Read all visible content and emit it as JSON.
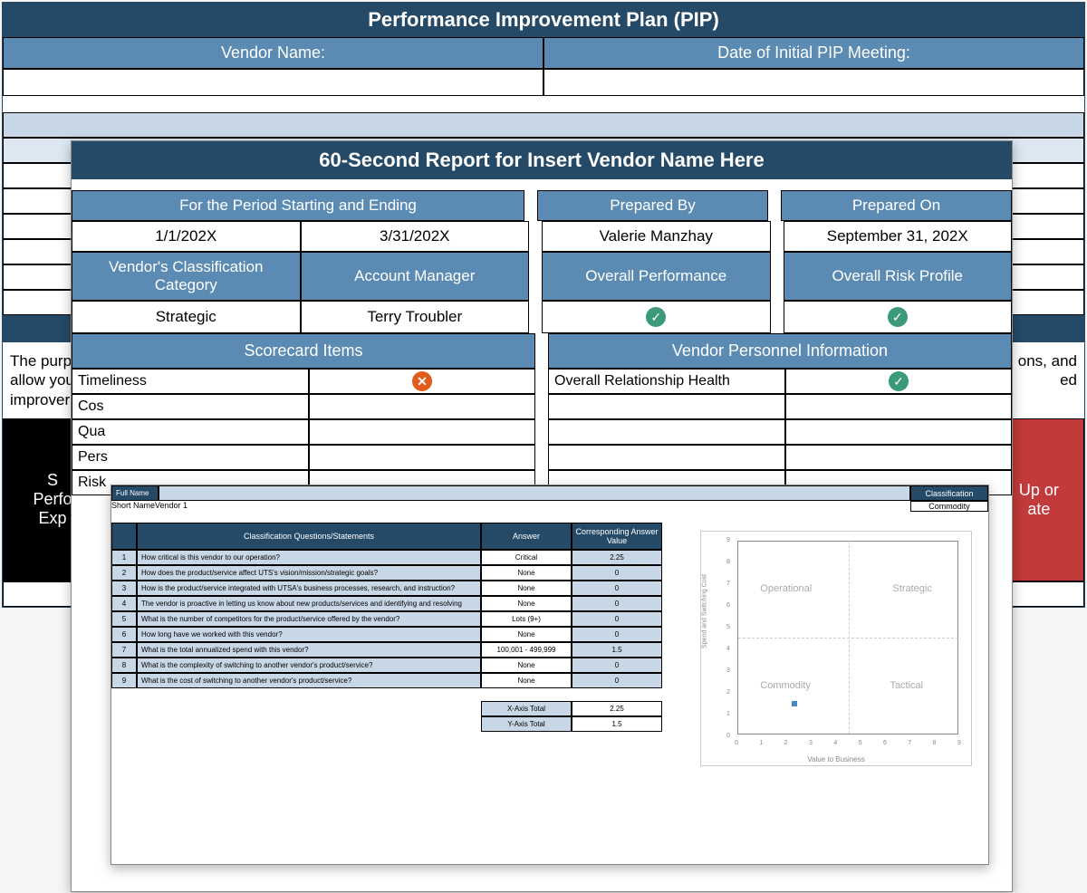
{
  "pip": {
    "title": "Performance Improvement Plan (PIP)",
    "vendor_name_label": "Vendor Name:",
    "date_meeting_label": "Date of Initial PIP Meeting:",
    "purpose_left_fragment": "The purp",
    "purpose_line2_fragment": "allow you",
    "purpose_line3_fragment": "improver",
    "purpose_right_fragment1": "ons, and",
    "purpose_right_fragment2": "ed",
    "col_left_partial1": "S",
    "col_left_partial2": "Perfo",
    "col_left_partial3": "Exp",
    "col_right_partial1": "Up or",
    "col_right_partial2": "ate"
  },
  "report": {
    "title": "60-Second Report for Insert Vendor Name Here",
    "period_header": "For the Period Starting and Ending",
    "period_start": "1/1/202X",
    "period_end": "3/31/202X",
    "prepared_by_header": "Prepared By",
    "prepared_by_value": "Valerie Manzhay",
    "prepared_on_header": "Prepared On",
    "prepared_on_value": "September 31, 202X",
    "class_cat_header": "Vendor's Classification Category",
    "class_cat_value": "Strategic",
    "acct_mgr_header": "Account Manager",
    "acct_mgr_value": "Terry Troubler",
    "overall_perf_header": "Overall Performance",
    "overall_risk_header": "Overall Risk Profile",
    "scorecard_header": "Scorecard Items",
    "vendor_personnel_header": "Vendor Personnel Information",
    "scorecard_items": {
      "timeliness": "Timeliness",
      "cost": "Cos",
      "quality": "Qua",
      "personnel": "Pers",
      "risk": "Risk"
    },
    "rel_health": "Overall Relationship Health"
  },
  "classification": {
    "full_name_label": "Full Name",
    "short_name_label": "Short Name",
    "short_name_value": "Vendor 1",
    "class_label": "Classification",
    "class_value": "Commodity",
    "table_headers": {
      "questions": "Classification Questions/Statements",
      "answer": "Answer",
      "value": "Corresponding Answer Value"
    },
    "rows": [
      {
        "n": "1",
        "q": "How critical is this vendor to our operation?",
        "a": "Critical",
        "v": "2.25"
      },
      {
        "n": "2",
        "q": "How does the product/service affect UTS's vision/mission/strategic goals?",
        "a": "None",
        "v": "0"
      },
      {
        "n": "3",
        "q": "How is the product/service integrated with UTSA's business processes, research, and instruction?",
        "a": "None",
        "v": "0"
      },
      {
        "n": "4",
        "q": "The vendor is proactive in letting us know about new products/services and identifying and resolving",
        "a": "None",
        "v": "0"
      },
      {
        "n": "5",
        "q": "What is the number of competitors for the product/service offered by the vendor?",
        "a": "Lots (9+)",
        "v": "0"
      },
      {
        "n": "6",
        "q": "How long have we worked with this vendor?",
        "a": "None",
        "v": "0"
      },
      {
        "n": "7",
        "q": "What is the total annualized spend with this vendor?",
        "a": "100,001 - 499,999",
        "v": "1.5"
      },
      {
        "n": "8",
        "q": "What is the complexity of switching to another vendor's product/service?",
        "a": "None",
        "v": "0"
      },
      {
        "n": "9",
        "q": "What is the cost of switching to another vendor's product/service?",
        "a": "None",
        "v": "0"
      }
    ],
    "x_total_label": "X-Axis Total",
    "x_total_value": "2.25",
    "y_total_label": "Y-Axis Total",
    "y_total_value": "1.5"
  },
  "chart_data": {
    "type": "scatter",
    "title": "",
    "xlabel": "Value to Business",
    "ylabel": "Spend and Switching Cost",
    "xlim": [
      0,
      9
    ],
    "ylim": [
      0,
      9
    ],
    "x_ticks": [
      "0",
      "1",
      "2",
      "3",
      "4",
      "5",
      "6",
      "7",
      "8",
      "9"
    ],
    "y_ticks": [
      "0",
      "1",
      "2",
      "3",
      "4",
      "5",
      "6",
      "7",
      "8",
      "9"
    ],
    "quadrants": {
      "top_left": "Operational",
      "top_right": "Strategic",
      "bottom_left": "Commodity",
      "bottom_right": "Tactical"
    },
    "series": [
      {
        "name": "Vendor 1",
        "x": [
          2.25
        ],
        "y": [
          1.5
        ]
      }
    ]
  }
}
